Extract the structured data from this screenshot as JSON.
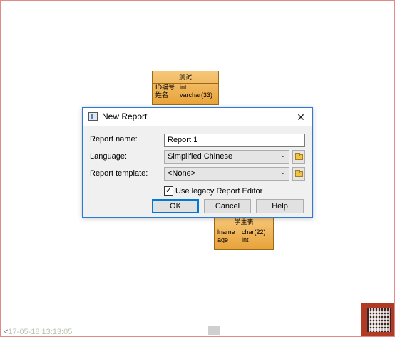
{
  "entities": [
    {
      "title": "测试",
      "rows": [
        {
          "name": "ID编号",
          "type": "int"
        },
        {
          "name": "姓名",
          "type": "varchar(33)"
        }
      ]
    },
    {
      "title": "学生表",
      "rows": [
        {
          "name": "lname",
          "type": "char(22)"
        },
        {
          "name": "age",
          "type": "int"
        }
      ]
    }
  ],
  "status": {
    "arrow": "<",
    "timestamp": "17-05-18 13:13:05"
  },
  "dialog": {
    "title": "New Report",
    "close_glyph": "✕",
    "report_name_label": "Report name:",
    "report_name_value": "Report 1",
    "language_label": "Language:",
    "language_value": "Simplified Chinese",
    "template_label": "Report template:",
    "template_value": "<None>",
    "legacy_checkbox_label": "Use legacy Report Editor",
    "legacy_checked": true,
    "check_glyph": "✓",
    "ok_label": "OK",
    "cancel_label": "Cancel",
    "help_label": "Help"
  },
  "colors": {
    "entity_fill": "#e8a33a",
    "dialog_border": "#2b79d8",
    "primary_button_border": "#0078d7"
  }
}
